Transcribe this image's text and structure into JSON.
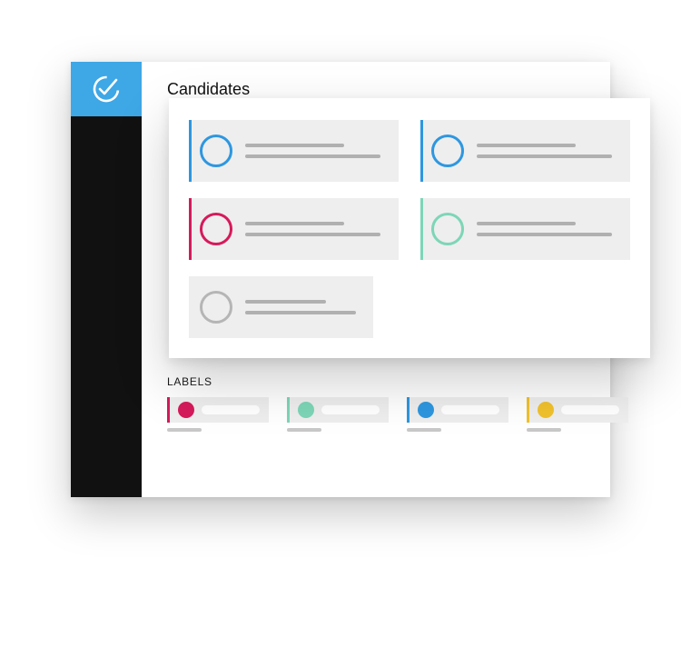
{
  "header": {
    "title": "Candidates"
  },
  "section": {
    "labels_title": "LABELS"
  },
  "colors": {
    "blue": "#2e97e0",
    "pink": "#d61a5b",
    "mint": "#7dd6b7",
    "yellow": "#f1c22d",
    "gray": "#b5b5b5"
  },
  "candidates": [
    {
      "color_key": "blue",
      "accent": true
    },
    {
      "color_key": "blue",
      "accent": true
    },
    {
      "color_key": "pink",
      "accent": true
    },
    {
      "color_key": "mint",
      "accent": true
    },
    {
      "color_key": "gray",
      "accent": false
    }
  ],
  "labels": [
    {
      "color_key": "pink"
    },
    {
      "color_key": "mint"
    },
    {
      "color_key": "blue"
    },
    {
      "color_key": "yellow"
    }
  ]
}
